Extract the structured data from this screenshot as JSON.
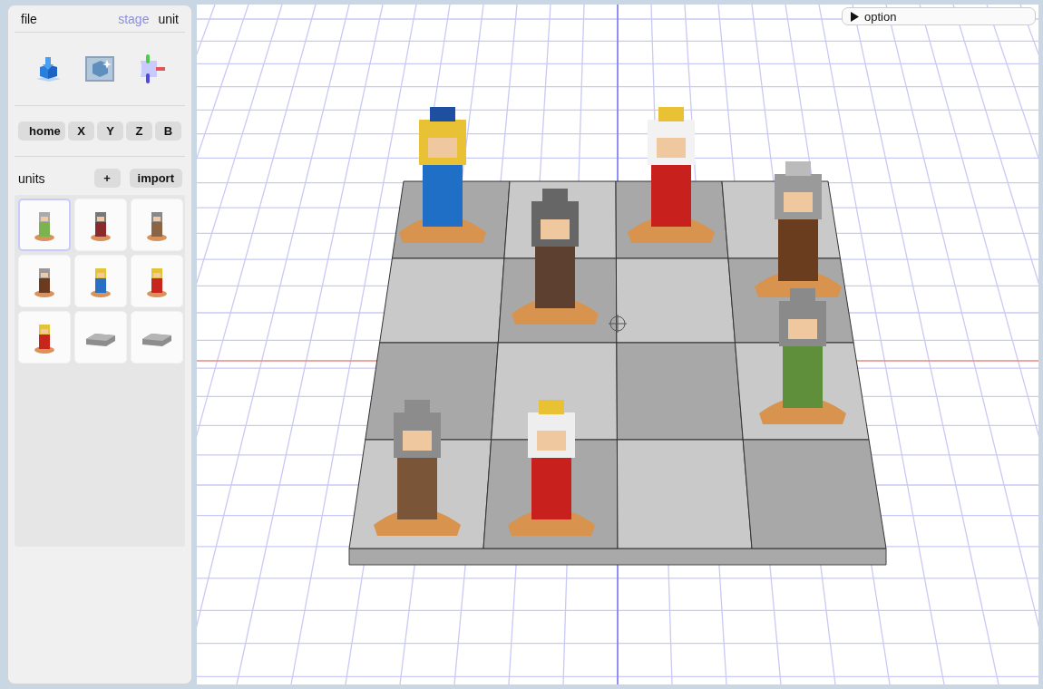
{
  "menu": {
    "label": "file"
  },
  "tabs": [
    {
      "label": "stage",
      "selected": true
    },
    {
      "label": "unit",
      "selected": false
    }
  ],
  "view_buttons": [
    "home",
    "X",
    "Y",
    "Z",
    "B"
  ],
  "units": {
    "label": "units",
    "add": "+",
    "import": "import",
    "items": [
      {
        "kind": "figure",
        "selected": true
      },
      {
        "kind": "figure",
        "selected": false
      },
      {
        "kind": "figure",
        "selected": false
      },
      {
        "kind": "figure",
        "selected": false
      },
      {
        "kind": "figure",
        "selected": false
      },
      {
        "kind": "figure",
        "selected": false
      },
      {
        "kind": "figure",
        "selected": false
      },
      {
        "kind": "tile",
        "selected": false
      },
      {
        "kind": "tile",
        "selected": false
      }
    ]
  },
  "option": {
    "label": "option",
    "expanded": false
  }
}
